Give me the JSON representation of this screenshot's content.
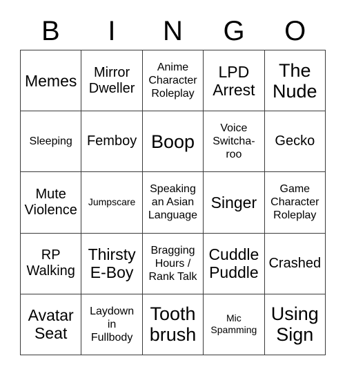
{
  "card": {
    "header_letters": [
      "B",
      "I",
      "N",
      "G",
      "O"
    ],
    "columns": 5,
    "rows": 5,
    "border_color": "#3a3a3a",
    "text_color": "#000000",
    "background_color": "#ffffff",
    "cells": [
      [
        {
          "text": "Memes",
          "size": "lg"
        },
        {
          "text": "Mirror\nDweller",
          "size": "md"
        },
        {
          "text": "Anime\nCharacter\nRoleplay",
          "size": "sm"
        },
        {
          "text": "LPD\nArrest",
          "size": "lg"
        },
        {
          "text": "The\nNude",
          "size": "xl"
        }
      ],
      [
        {
          "text": "Sleeping",
          "size": "sm"
        },
        {
          "text": "Femboy",
          "size": "md"
        },
        {
          "text": "Boop",
          "size": "xl"
        },
        {
          "text": "Voice\nSwitcha-\nroo",
          "size": "sm"
        },
        {
          "text": "Gecko",
          "size": "md"
        }
      ],
      [
        {
          "text": "Mute\nViolence",
          "size": "md"
        },
        {
          "text": "Jumpscare",
          "size": "xs"
        },
        {
          "text": "Speaking\nan Asian\nLanguage",
          "size": "sm"
        },
        {
          "text": "Singer",
          "size": "lg"
        },
        {
          "text": "Game\nCharacter\nRoleplay",
          "size": "sm"
        }
      ],
      [
        {
          "text": "RP\nWalking",
          "size": "md"
        },
        {
          "text": "Thirsty\nE-Boy",
          "size": "lg"
        },
        {
          "text": "Bragging\nHours /\nRank Talk",
          "size": "sm"
        },
        {
          "text": "Cuddle\nPuddle",
          "size": "lg"
        },
        {
          "text": "Crashed",
          "size": "md"
        }
      ],
      [
        {
          "text": "Avatar\nSeat",
          "size": "lg"
        },
        {
          "text": "Laydown\nin\nFullbody",
          "size": "sm"
        },
        {
          "text": "Tooth\nbrush",
          "size": "xl"
        },
        {
          "text": "Mic\nSpamming",
          "size": "xs"
        },
        {
          "text": "Using\nSign",
          "size": "xl"
        }
      ]
    ]
  }
}
